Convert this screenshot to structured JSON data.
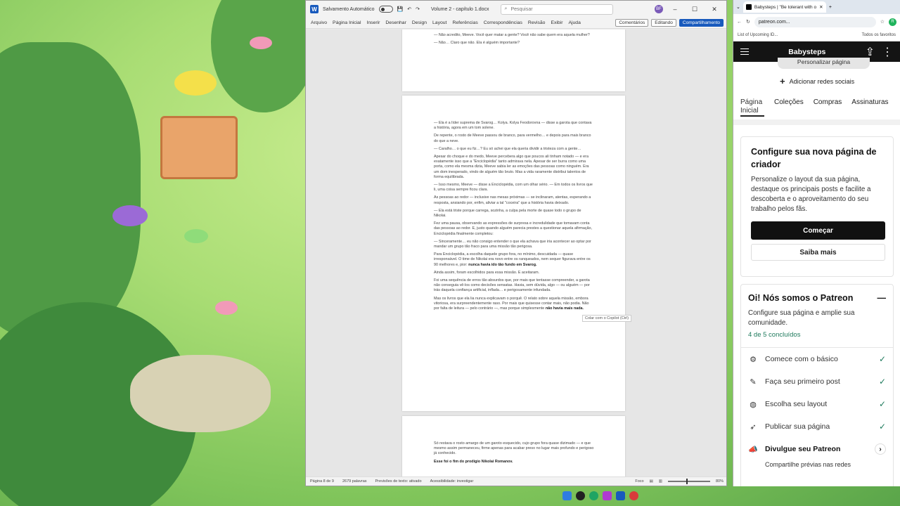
{
  "word": {
    "autosave_label": "Salvamento Automático",
    "doc_title": "Volume 2 - capítulo 1.docx",
    "search_placeholder": "Pesquisar",
    "user_initials": "BF",
    "menu": [
      "Arquivo",
      "Página Inicial",
      "Inserir",
      "Desenhar",
      "Design",
      "Layout",
      "Referências",
      "Correspondências",
      "Revisão",
      "Exibir",
      "Ajuda"
    ],
    "comments_label": "Comentários",
    "editing_label": "Editando",
    "share_label": "Compartilhamento",
    "page1_lines": [
      "— Não acredito, Meeve. Você quer matar a gente? Você não sabe quem era aquela mulher?",
      "— Não… Claro que não. Ela é alguém importante?"
    ],
    "page2_paragraphs": [
      "— Ela é a líder suprema de Svarog… Kolya. Kolya Feodorovna — disse a garota que contava a história, agora em um tom solene.",
      "De repente, o rosto de Meeve passou de branco, para vermelho… e depois para mais branco do que a neve.",
      "— Caralho… o que eu fiz…? Eu só achei que ela queria dividir a tristeza com a gente…",
      "Apesar do choque e do medo, Meeve percebera algo que poucos ali tinham notado — e era exatamente isso que a \"Enciclopédia\" tanto admirava nela. Apesar de ser burra como uma porta, como ela mesma dizia, Meeve sabia ler as emoções das pessoas como ninguém. Era um dom inesperado, vindo de alguém tão bruto. Mas a vida raramente distribui talentos de forma equilibrada.",
      "— Isso mesmo, Meeve — disse a Enciclopédia, com um olhar sério. — Em todos os livros que li, uma coisa sempre ficou clara.",
      "As pessoas ao redor — inclusive nas mesas próximas — se inclinaram, atentas, esperando a resposta, ansiando por, enfim, aliviar a tal \"coceira\" que a história havia deixado.",
      "— Ela está triste porque carrega, sozinha, a culpa pela morte de quase todo o grupo de Nikolai.",
      "Fez uma pausa, observando as expressões de surpresa e incredulidade que tomavam conta das pessoas ao redor. E, justo quando alguém parecia prestes a questionar aquela afirmação, Enciclopédia finalmente completou:",
      "— Sinceramente… eu não consigo entender o que ela achava que iria acontecer ao optar por mandar um grupo tão fraco para uma missão tão perigosa.",
      "Para Enciclopédia, a escolha daquele grupo fora, no mínimo, descuidada — quase irresponsável. O time de Nikolai era novo entre os ranqueados, nem sequer figurava entre os 90 melhores e, pior:",
      "Ainda assim, foram escolhidos para essa missão. E aceitaram.",
      "Foi uma sequência de erros tão absurdos que, por mais que tentasse compreender, a garota não conseguia vê-los como decisões sensatas. Havia, sem dúvida, algo — ou alguém — por trás daquela confiança artificial, inflada… e perigosamente infundada.",
      "Mas os livros que ela lia nunca explicavam o porquê. O relato sobre aquela missão, embora vitoriosa, era surpreendentemente raso. Por mais que quisesse contar mais, não podia. Não por falta de leitura — pelo contrário —, mas porque simplesmente"
    ],
    "bold_1": "nunca havia ido tão fundo em Svarog.",
    "bold_2": "não havia mais nada.",
    "page3_paragraphs": [
      "Só restava o rosto amargo de um garoto esquecido, cujo grupo fora quase dizimado — e que mesmo assim permaneceu, firme apenas para acabar preso no lugar mais profundo e perigoso já conhecido."
    ],
    "page3_bold": "Esse foi o fim do prodígio Nikolai Romanov.",
    "copilot_tip": "Colar com o Copilot (Ctrl)",
    "status": {
      "page": "Página 8 de 9",
      "words": "2679 palavras",
      "predictions": "Previsões de texto: ativado",
      "accessibility": "Acessibilidade: investigar",
      "focus": "Foco",
      "zoom": "80%"
    }
  },
  "browser": {
    "tab_title": "Babysteps | \"Be tolerant with o",
    "url": "patreon.com...",
    "bookmark": "List of Upcoming ID...",
    "bookmarks_all": "Todos os favoritos",
    "profile_initial": "R"
  },
  "patreon": {
    "header_title": "Babysteps",
    "personalize_label": "Personalizar página",
    "add_social_label": "Adicionar redes sociais",
    "tabs": [
      "Página Inicial",
      "Coleções",
      "Compras",
      "Assinaturas"
    ],
    "config_title": "Configure sua nova página de criador",
    "config_desc": "Personalize o layout da sua página, destaque os principais posts e facilite a descoberta e o aproveitamento do seu trabalho pelos fãs.",
    "start_label": "Começar",
    "learn_more_label": "Saiba mais",
    "oi_title": "Oi! Nós somos o Patreon",
    "oi_desc": "Configure sua página e amplie sua comunidade.",
    "progress_text": "4 de 5 concluídos",
    "tasks": [
      {
        "label": "Comece com o básico",
        "done": true,
        "icon": "gear-icon"
      },
      {
        "label": "Faça seu primeiro post",
        "done": true,
        "icon": "edit-icon"
      },
      {
        "label": "Escolha seu layout",
        "done": true,
        "icon": "palette-icon"
      },
      {
        "label": "Publicar sua página",
        "done": true,
        "icon": "rocket-icon"
      },
      {
        "label": "Divulgue seu Patreon",
        "done": false,
        "icon": "megaphone-icon"
      }
    ],
    "next_task_sub": "Compartilhe prévias nas redes"
  },
  "colors": {
    "word_blue": "#185abd",
    "patreon_header": "#141414",
    "success_green": "#1e7a5c"
  }
}
